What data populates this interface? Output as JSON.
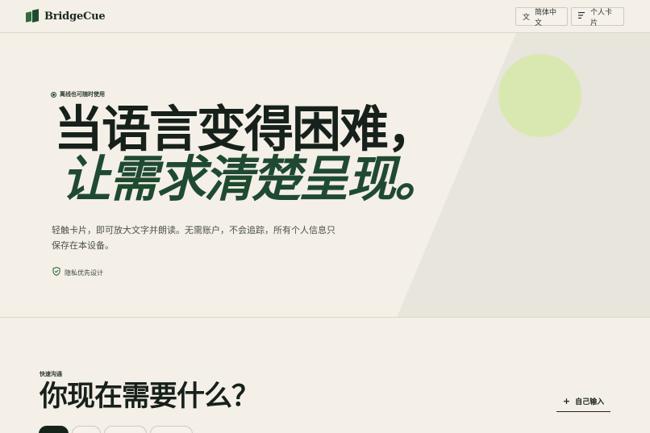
{
  "header": {
    "brand": "BridgeCue",
    "lang_button": {
      "icon": "translate-icon",
      "glyph": "文",
      "label": "简体中文"
    },
    "card_button": {
      "icon": "list-icon",
      "glyph": "☰",
      "label": "个人卡片"
    }
  },
  "hero": {
    "eyebrow": "离线也可随时使用",
    "title_line1": "当语言变得困难，",
    "title_line2": "让需求清楚呈现。",
    "lead": "轻触卡片，即可放大文字并朗读。无需账户，不会追踪，所有个人信息只保存在本设备。",
    "privacy": {
      "icon": "shield-check-icon",
      "label": "隐私优先设计"
    }
  },
  "quick": {
    "kicker": "快速沟通",
    "title": "你现在需要什么？",
    "own_input": {
      "icon": "plus-icon",
      "label": "自己输入"
    }
  },
  "colors": {
    "background": "#f4efe7",
    "accent_green": "#1f4a31",
    "circle": "#d8e8b0",
    "diagonal_panel": "#e7e5dc"
  }
}
